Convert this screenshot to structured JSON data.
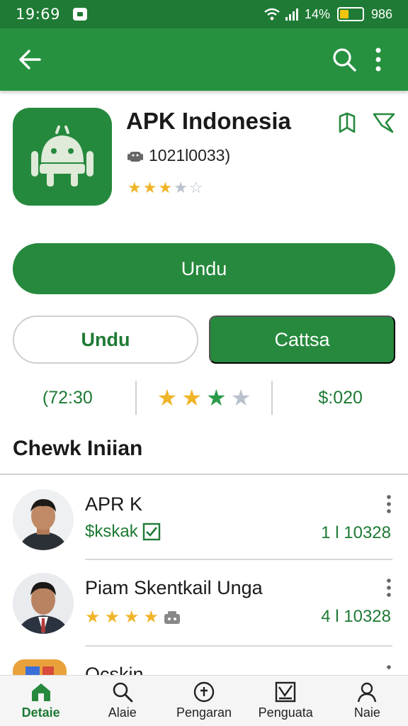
{
  "status_bar": {
    "time": "19:69",
    "battery_text": "14%",
    "signal_text": "986"
  },
  "app": {
    "title": "APK Indonesia",
    "meta": "1021l0033)",
    "rating_stars": 3
  },
  "buttons": {
    "primary_label": "Undu",
    "outline_label": "Undu",
    "filled_label": "Cattsa"
  },
  "stats": {
    "left": "(72:30",
    "stars_filled": 3,
    "right": "$:020"
  },
  "section": {
    "title": "Chewk Iniian"
  },
  "list": [
    {
      "name": "APR K",
      "sub": "$kskak",
      "count": "1 l 10328"
    },
    {
      "name": "Piam Skentkail Unga",
      "sub": "",
      "count": "4 l 10328"
    },
    {
      "name": "Ocskin"
    }
  ],
  "nav": [
    {
      "label": "Detaie",
      "icon": "home-icon",
      "active": true
    },
    {
      "label": "Alaie",
      "icon": "search-icon",
      "active": false
    },
    {
      "label": "Pengaran",
      "icon": "info-circle-icon",
      "active": false
    },
    {
      "label": "Penguata",
      "icon": "chart-box-icon",
      "active": false
    },
    {
      "label": "Naie",
      "icon": "profile-icon",
      "active": false
    }
  ],
  "colors": {
    "primary": "#26893d",
    "dark_primary": "#1e7a34",
    "star": "#f0b429"
  }
}
